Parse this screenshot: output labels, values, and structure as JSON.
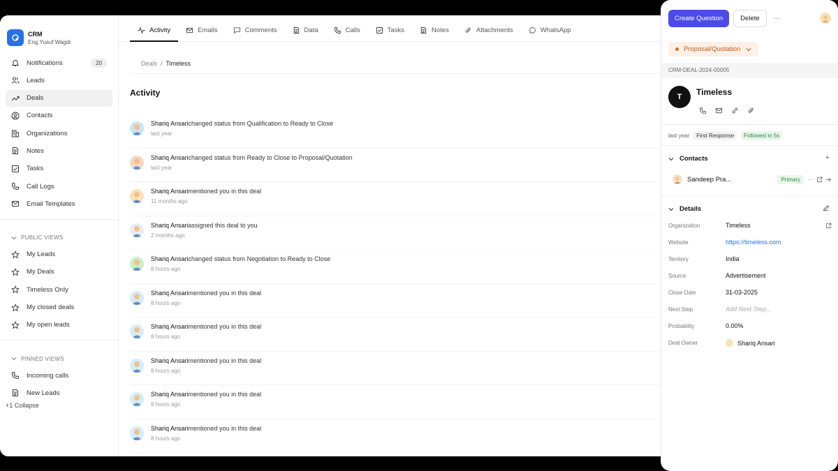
{
  "app": {
    "name": "CRM",
    "user": "Eng.Yusuf Wagdi"
  },
  "sidebar": {
    "items": [
      {
        "label": "Notifications",
        "badge": "20",
        "icon": "bell-icon"
      },
      {
        "label": "Leads",
        "icon": "users-icon"
      },
      {
        "label": "Deals",
        "icon": "trending-icon",
        "active": true
      },
      {
        "label": "Contacts",
        "icon": "contact-icon"
      },
      {
        "label": "Organizations",
        "icon": "building-icon"
      },
      {
        "label": "Notes",
        "icon": "note-icon"
      },
      {
        "label": "Tasks",
        "icon": "checkbox-icon"
      },
      {
        "label": "Call Logs",
        "icon": "phone-icon"
      },
      {
        "label": "Email Templates",
        "icon": "mail-icon"
      }
    ],
    "public_views_label": "PUBLIC VIEWS",
    "public_views": [
      "My Leads",
      "My Deals",
      "Timeless Only",
      "My closed deals",
      "My open leads"
    ],
    "pinned_views_label": "PINNED VIEWS",
    "pinned_views": [
      "Incoming calls",
      "New Leads"
    ],
    "collapse_label": "Collapse",
    "collapse_prefix": "+1"
  },
  "tabs": [
    "Activity",
    "Emails",
    "Comments",
    "Data",
    "Calls",
    "Tasks",
    "Notes",
    "Attachments",
    "WhatsApp"
  ],
  "breadcrumb": {
    "root": "Deals",
    "sep": "/",
    "current": "Timeless"
  },
  "activity_title": "Activity",
  "feed": [
    {
      "who": "Shariq Ansari",
      "text": "changed status from Qualification to Ready to Close",
      "time": "last year",
      "avatar_color": "#c7e6f5"
    },
    {
      "who": "Shariq Ansari",
      "text": "changed status from Ready to Close to Proposal/Quotation",
      "time": "last year",
      "avatar_color": "#f2d9c4"
    },
    {
      "who": "Shariq Ansari",
      "text": "mentioned you in this deal",
      "time": "11 months ago",
      "avatar_color": "#fde2b8"
    },
    {
      "who": "Shariq Ansari",
      "text": "assigned this deal to you",
      "time": "2 months ago",
      "avatar_color": "#e8ecf3"
    },
    {
      "who": "Shariq Ansari",
      "text": "changed status from Negotiation to Ready to Close",
      "time": "8 hours ago",
      "avatar_color": "#c9f0c4"
    },
    {
      "who": "Shariq Ansari",
      "text": "mentioned you in this deal",
      "time": "8 hours ago",
      "avatar_color": "#d6ecfa"
    },
    {
      "who": "Shariq Ansari",
      "text": "mentioned you in this deal",
      "time": "8 hours ago",
      "avatar_color": "#d6ecfa"
    },
    {
      "who": "Shariq Ansari",
      "text": "mentioned you in this deal",
      "time": "8 hours ago",
      "avatar_color": "#d6ecfa"
    },
    {
      "who": "Shariq Ansari",
      "text": "mentioned you in this deal",
      "time": "8 hours ago",
      "avatar_color": "#d6ecfa"
    },
    {
      "who": "Shariq Ansari",
      "text": "mentioned you in this deal",
      "time": "8 hours ago",
      "avatar_color": "#d6ecfa"
    }
  ],
  "panel": {
    "create_label": "Create Question",
    "delete_label": "Delete",
    "more_label": "···",
    "status": "Proposal/Quotation",
    "deal_id": "CRM-DEAL-2024-00005",
    "org_initial": "T",
    "org_name": "Timeless",
    "response": {
      "time": "last year",
      "first_label": "First Response",
      "followed_label": "Followed in 5s"
    },
    "contacts_title": "Contacts",
    "contact": {
      "name": "Sandeep Pra...",
      "tag": "Primary"
    },
    "details_title": "Details",
    "details": [
      {
        "key": "Organization",
        "value": "Timeless",
        "style": ""
      },
      {
        "key": "Website",
        "value": "https://timeless.com",
        "style": "link"
      },
      {
        "key": "Territory",
        "value": "India",
        "style": ""
      },
      {
        "key": "Source",
        "value": "Advertisement",
        "style": ""
      },
      {
        "key": "Close Date",
        "value": "31-03-2025",
        "style": ""
      },
      {
        "key": "Next Step",
        "value": "Add Next Step...",
        "style": "ph"
      },
      {
        "key": "Probability",
        "value": "0.00%",
        "style": ""
      },
      {
        "key": "Deal Owner",
        "value": "Shariq Ansari",
        "style": "owner"
      }
    ]
  },
  "colors": {
    "primary": "#4b4be8",
    "brand": "#2b6fe7",
    "status": "#c45a12",
    "success": "#2c8a3f"
  }
}
